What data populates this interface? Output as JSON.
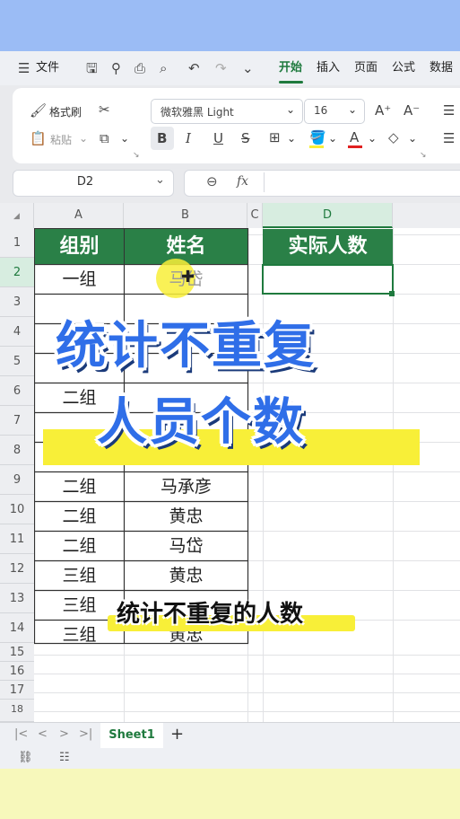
{
  "menu": {
    "file_label": "文件",
    "tabs": [
      "开始",
      "插入",
      "页面",
      "公式",
      "数据"
    ],
    "active_tab": "开始"
  },
  "ribbon": {
    "format_painter": "格式刷",
    "paste": "粘贴",
    "font_name": "微软雅黑 Light",
    "font_size": "16",
    "bold": "B",
    "italic": "I",
    "underline": "U",
    "strike": "S"
  },
  "formula_bar": {
    "name_box": "D2",
    "fx": "fx",
    "value": ""
  },
  "sheet": {
    "columns": [
      "A",
      "B",
      "C",
      "D"
    ],
    "row_numbers": [
      "1",
      "2",
      "3",
      "4",
      "5",
      "6",
      "7",
      "8",
      "9",
      "10",
      "11",
      "12",
      "13",
      "14",
      "15",
      "16",
      "17",
      "18"
    ],
    "header": {
      "a": "组别",
      "b": "姓名",
      "d": "实际人数"
    },
    "rows": [
      {
        "a": "一组",
        "b": "马岱"
      },
      {
        "a": "",
        "b": ""
      },
      {
        "a": "",
        "b": ""
      },
      {
        "a": "",
        "b": ""
      },
      {
        "a": "二组",
        "b": ""
      },
      {
        "a": "",
        "b": ""
      },
      {
        "a": "",
        "b": ""
      },
      {
        "a": "二组",
        "b": "马承彦"
      },
      {
        "a": "二组",
        "b": "黄忠"
      },
      {
        "a": "二组",
        "b": "马岱"
      },
      {
        "a": "三组",
        "b": "黄忠"
      },
      {
        "a": "三组",
        "b": ""
      },
      {
        "a": "三组",
        "b": "黄忠"
      }
    ],
    "selected_cell": "D2"
  },
  "tabs_bar": {
    "sheet_name": "Sheet1",
    "add": "+"
  },
  "overlay": {
    "title_line1": "统计不重复",
    "title_line2": "人员个数",
    "caption": "统计不重复的人数"
  },
  "colors": {
    "header_green": "#2a8047",
    "title_blue": "#2f6ee8",
    "highlight_yellow": "#f8ef38"
  }
}
